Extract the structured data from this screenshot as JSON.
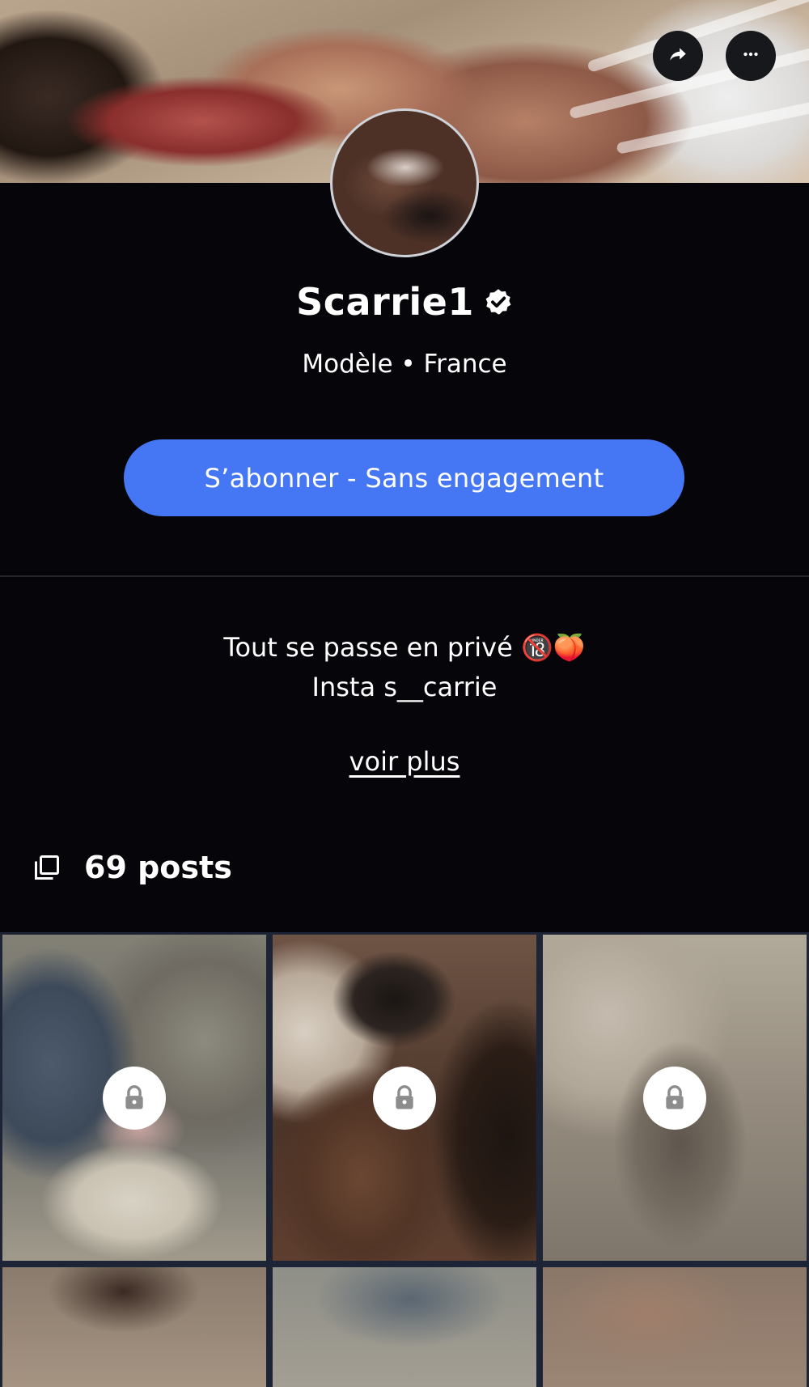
{
  "header": {
    "share_icon": "share-arrow-icon",
    "more_icon": "more-horizontal-icon"
  },
  "profile": {
    "name": "Scarrie1",
    "verified_icon": "verified-badge-icon",
    "subtitle": "Modèle • France",
    "subscribe_label": "S’abonner - Sans engagement",
    "bio_line1": "Tout se passe en privé 🔞🍑",
    "bio_line2": "Insta s__carrie",
    "see_more_label": "voir plus"
  },
  "posts": {
    "icon": "posts-stack-icon",
    "count_label": "69 posts",
    "grid": [
      {
        "locked": true
      },
      {
        "locked": true
      },
      {
        "locked": true
      },
      {
        "locked": false
      },
      {
        "locked": false
      },
      {
        "locked": false
      }
    ]
  },
  "colors": {
    "background": "#05050a",
    "accent": "#4577f5",
    "text": "#ffffff"
  }
}
